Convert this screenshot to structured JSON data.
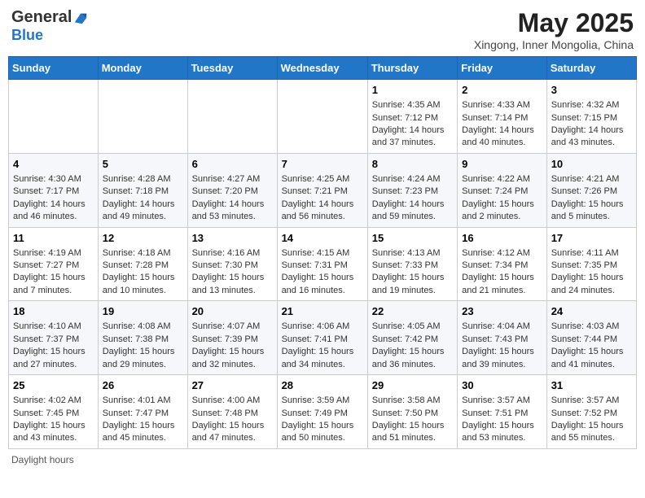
{
  "header": {
    "logo_general": "General",
    "logo_blue": "Blue",
    "month_title": "May 2025",
    "location": "Xingong, Inner Mongolia, China"
  },
  "days_of_week": [
    "Sunday",
    "Monday",
    "Tuesday",
    "Wednesday",
    "Thursday",
    "Friday",
    "Saturday"
  ],
  "weeks": [
    [
      {
        "day": "",
        "info": ""
      },
      {
        "day": "",
        "info": ""
      },
      {
        "day": "",
        "info": ""
      },
      {
        "day": "",
        "info": ""
      },
      {
        "day": "1",
        "info": "Sunrise: 4:35 AM\nSunset: 7:12 PM\nDaylight: 14 hours\nand 37 minutes."
      },
      {
        "day": "2",
        "info": "Sunrise: 4:33 AM\nSunset: 7:14 PM\nDaylight: 14 hours\nand 40 minutes."
      },
      {
        "day": "3",
        "info": "Sunrise: 4:32 AM\nSunset: 7:15 PM\nDaylight: 14 hours\nand 43 minutes."
      }
    ],
    [
      {
        "day": "4",
        "info": "Sunrise: 4:30 AM\nSunset: 7:17 PM\nDaylight: 14 hours\nand 46 minutes."
      },
      {
        "day": "5",
        "info": "Sunrise: 4:28 AM\nSunset: 7:18 PM\nDaylight: 14 hours\nand 49 minutes."
      },
      {
        "day": "6",
        "info": "Sunrise: 4:27 AM\nSunset: 7:20 PM\nDaylight: 14 hours\nand 53 minutes."
      },
      {
        "day": "7",
        "info": "Sunrise: 4:25 AM\nSunset: 7:21 PM\nDaylight: 14 hours\nand 56 minutes."
      },
      {
        "day": "8",
        "info": "Sunrise: 4:24 AM\nSunset: 7:23 PM\nDaylight: 14 hours\nand 59 minutes."
      },
      {
        "day": "9",
        "info": "Sunrise: 4:22 AM\nSunset: 7:24 PM\nDaylight: 15 hours\nand 2 minutes."
      },
      {
        "day": "10",
        "info": "Sunrise: 4:21 AM\nSunset: 7:26 PM\nDaylight: 15 hours\nand 5 minutes."
      }
    ],
    [
      {
        "day": "11",
        "info": "Sunrise: 4:19 AM\nSunset: 7:27 PM\nDaylight: 15 hours\nand 7 minutes."
      },
      {
        "day": "12",
        "info": "Sunrise: 4:18 AM\nSunset: 7:28 PM\nDaylight: 15 hours\nand 10 minutes."
      },
      {
        "day": "13",
        "info": "Sunrise: 4:16 AM\nSunset: 7:30 PM\nDaylight: 15 hours\nand 13 minutes."
      },
      {
        "day": "14",
        "info": "Sunrise: 4:15 AM\nSunset: 7:31 PM\nDaylight: 15 hours\nand 16 minutes."
      },
      {
        "day": "15",
        "info": "Sunrise: 4:13 AM\nSunset: 7:33 PM\nDaylight: 15 hours\nand 19 minutes."
      },
      {
        "day": "16",
        "info": "Sunrise: 4:12 AM\nSunset: 7:34 PM\nDaylight: 15 hours\nand 21 minutes."
      },
      {
        "day": "17",
        "info": "Sunrise: 4:11 AM\nSunset: 7:35 PM\nDaylight: 15 hours\nand 24 minutes."
      }
    ],
    [
      {
        "day": "18",
        "info": "Sunrise: 4:10 AM\nSunset: 7:37 PM\nDaylight: 15 hours\nand 27 minutes."
      },
      {
        "day": "19",
        "info": "Sunrise: 4:08 AM\nSunset: 7:38 PM\nDaylight: 15 hours\nand 29 minutes."
      },
      {
        "day": "20",
        "info": "Sunrise: 4:07 AM\nSunset: 7:39 PM\nDaylight: 15 hours\nand 32 minutes."
      },
      {
        "day": "21",
        "info": "Sunrise: 4:06 AM\nSunset: 7:41 PM\nDaylight: 15 hours\nand 34 minutes."
      },
      {
        "day": "22",
        "info": "Sunrise: 4:05 AM\nSunset: 7:42 PM\nDaylight: 15 hours\nand 36 minutes."
      },
      {
        "day": "23",
        "info": "Sunrise: 4:04 AM\nSunset: 7:43 PM\nDaylight: 15 hours\nand 39 minutes."
      },
      {
        "day": "24",
        "info": "Sunrise: 4:03 AM\nSunset: 7:44 PM\nDaylight: 15 hours\nand 41 minutes."
      }
    ],
    [
      {
        "day": "25",
        "info": "Sunrise: 4:02 AM\nSunset: 7:45 PM\nDaylight: 15 hours\nand 43 minutes."
      },
      {
        "day": "26",
        "info": "Sunrise: 4:01 AM\nSunset: 7:47 PM\nDaylight: 15 hours\nand 45 minutes."
      },
      {
        "day": "27",
        "info": "Sunrise: 4:00 AM\nSunset: 7:48 PM\nDaylight: 15 hours\nand 47 minutes."
      },
      {
        "day": "28",
        "info": "Sunrise: 3:59 AM\nSunset: 7:49 PM\nDaylight: 15 hours\nand 50 minutes."
      },
      {
        "day": "29",
        "info": "Sunrise: 3:58 AM\nSunset: 7:50 PM\nDaylight: 15 hours\nand 51 minutes."
      },
      {
        "day": "30",
        "info": "Sunrise: 3:57 AM\nSunset: 7:51 PM\nDaylight: 15 hours\nand 53 minutes."
      },
      {
        "day": "31",
        "info": "Sunrise: 3:57 AM\nSunset: 7:52 PM\nDaylight: 15 hours\nand 55 minutes."
      }
    ]
  ],
  "footer": {
    "daylight_label": "Daylight hours"
  }
}
